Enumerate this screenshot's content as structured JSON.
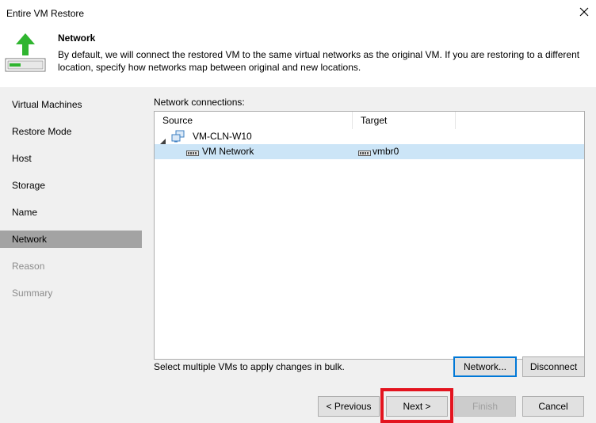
{
  "window": {
    "title": "Entire VM Restore",
    "bleed_texts": [
      "...",
      "...",
      "...",
      "..."
    ]
  },
  "header": {
    "title": "Network",
    "description": "By default, we will connect the restored VM to the same virtual networks as the original VM. If you are restoring to a different location, specify how networks map between original and new locations.",
    "icon": "restore-up-arrow-icon"
  },
  "sidebar": {
    "items": [
      {
        "label": "Virtual Machines",
        "state": "normal"
      },
      {
        "label": "Restore Mode",
        "state": "normal"
      },
      {
        "label": "Host",
        "state": "normal"
      },
      {
        "label": "Storage",
        "state": "normal"
      },
      {
        "label": "Name",
        "state": "normal"
      },
      {
        "label": "Network",
        "state": "active"
      },
      {
        "label": "Reason",
        "state": "disabled"
      },
      {
        "label": "Summary",
        "state": "disabled"
      }
    ]
  },
  "main": {
    "connections_label": "Network connections:",
    "columns": [
      "Source",
      "Target"
    ],
    "vm": {
      "name": "VM-CLN-W10",
      "icon": "vm-group-icon",
      "expander": "collapse-triangle-icon"
    },
    "rows": [
      {
        "source": "VM Network",
        "target": "vmbr0",
        "icon": "network-icon",
        "selected": true
      }
    ],
    "bulk_hint": "Select multiple VMs to apply changes in bulk.",
    "network_button": "Network...",
    "disconnect_button": "Disconnect"
  },
  "footer": {
    "previous": "< Previous",
    "next": "Next >",
    "finish": "Finish",
    "cancel": "Cancel"
  },
  "colors": {
    "accent": "#0078d7",
    "selection": "#cce5f7",
    "sidebar_active": "#a3a3a3",
    "highlight_box": "#e3141f",
    "arrow_green": "#2fb52f"
  }
}
